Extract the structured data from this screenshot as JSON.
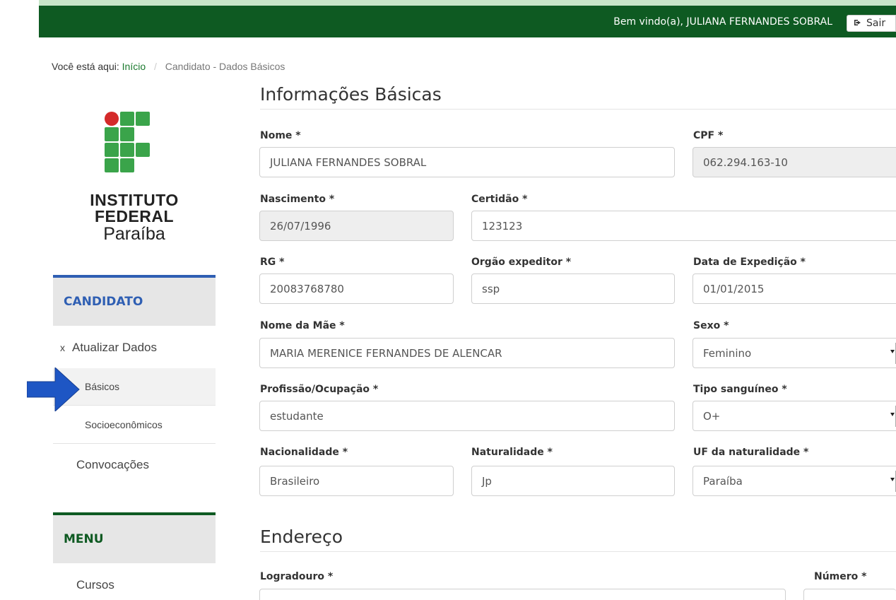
{
  "header": {
    "welcome_text": "Bem vindo(a), JULIANA FERNANDES SOBRAL",
    "logout_label": "Sair",
    "logout_icon": "sign-out-icon",
    "bar_color": "#0e5a22"
  },
  "breadcrumb": {
    "prefix": "Você está aqui:",
    "home": "Início",
    "separator": "/",
    "current": "Candidato - Dados Básicos"
  },
  "logo": {
    "line1": "INSTITUTO",
    "line2": "FEDERAL",
    "line3": "Paraíba"
  },
  "sidebar": {
    "candidate_heading": "CANDIDATO",
    "update_data_label": "Atualizar Dados",
    "update_data_icon": "x",
    "basic_label": "Básicos",
    "socio_label": "Socioeconômicos",
    "calls_label": "Convocações",
    "menu_heading": "MENU",
    "courses_label": "Cursos",
    "candidate_accent": "#2f5fb3"
  },
  "form": {
    "basic_title": "Informações Básicas",
    "address_title": "Endereço",
    "fields": {
      "nome": {
        "label": "Nome *",
        "value": "JULIANA FERNANDES SOBRAL"
      },
      "cpf": {
        "label": "CPF *",
        "value": "062.294.163-10"
      },
      "nascimento": {
        "label": "Nascimento *",
        "value": "26/07/1996"
      },
      "certidao": {
        "label": "Certidão *",
        "value": "123123"
      },
      "rg": {
        "label": "RG *",
        "value": "20083768780"
      },
      "orgao": {
        "label": "Orgão expeditor *",
        "value": "ssp"
      },
      "data_exp": {
        "label": "Data de Expedição *",
        "value": "01/01/2015"
      },
      "mae": {
        "label": "Nome da Mãe *",
        "value": "MARIA MERENICE FERNANDES DE ALENCAR"
      },
      "sexo": {
        "label": "Sexo *",
        "value": "Feminino"
      },
      "profissao": {
        "label": "Profissão/Ocupação *",
        "value": "estudante"
      },
      "tipo_sangue": {
        "label": "Tipo sanguíneo *",
        "value": "O+"
      },
      "nacionalidade": {
        "label": "Nacionalidade *",
        "value": "Brasileiro"
      },
      "naturalidade": {
        "label": "Naturalidade *",
        "value": "Jp"
      },
      "uf": {
        "label": "UF da naturalidade *",
        "value": "Paraíba"
      },
      "logradouro": {
        "label": "Logradouro *"
      },
      "numero": {
        "label": "Número *"
      }
    }
  }
}
